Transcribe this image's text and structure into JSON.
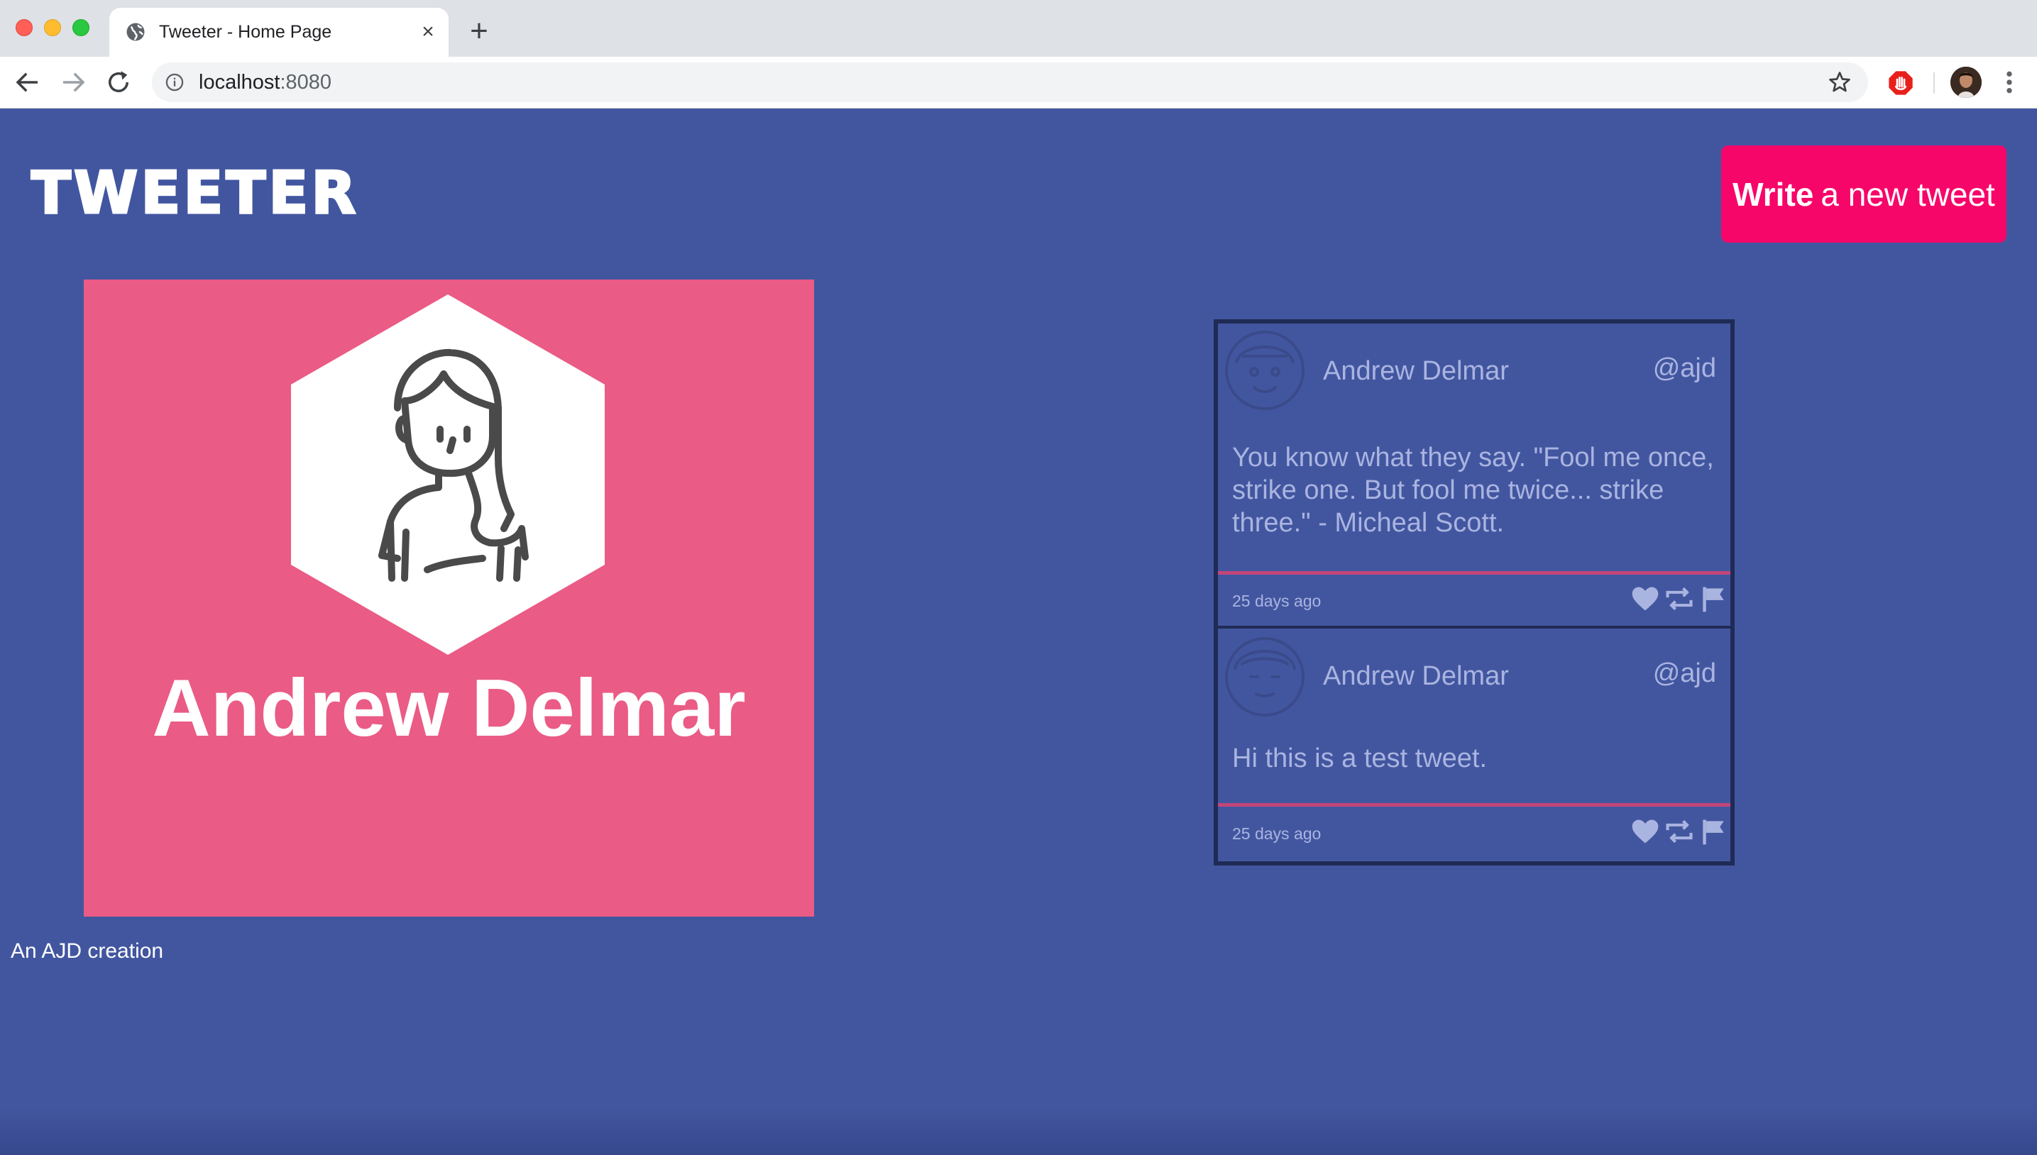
{
  "browser": {
    "tab_title": "Tweeter - Home Page",
    "tab_close": "×",
    "new_tab": "+",
    "url_host": "localhost",
    "url_port": ":8080",
    "icons": [
      "globe-icon",
      "close-icon",
      "plus-icon",
      "back-arrow-icon",
      "forward-arrow-icon",
      "reload-icon",
      "info-icon",
      "star-icon",
      "adblock-icon",
      "profile-avatar",
      "kebab-menu-icon"
    ]
  },
  "header": {
    "logo": "TWEETER",
    "compose_bold": "Write",
    "compose_rest": "a new tweet"
  },
  "profile": {
    "name": "Andrew Delmar",
    "card_color": "#ea5b85"
  },
  "tweets": [
    {
      "name": "Andrew Delmar",
      "handle": "@ajd",
      "body": "You know what they say. \"Fool me once, strike one. But fool me twice... strike three.\" - Micheal Scott.",
      "time": "25 days ago",
      "actions": [
        "heart-icon",
        "retweet-icon",
        "flag-icon"
      ]
    },
    {
      "name": "Andrew Delmar",
      "handle": "@ajd",
      "body": "Hi this is a test tweet.",
      "time": "25 days ago",
      "actions": [
        "heart-icon",
        "retweet-icon",
        "flag-icon"
      ]
    }
  ],
  "footer": {
    "text": "An AJD creation"
  },
  "colors": {
    "page_bg": "#4256a0",
    "accent": "#f7066a",
    "tweet_text": "#aab4e0",
    "tweet_border": "#1f2b55",
    "tweet_rule": "#c3457a"
  }
}
